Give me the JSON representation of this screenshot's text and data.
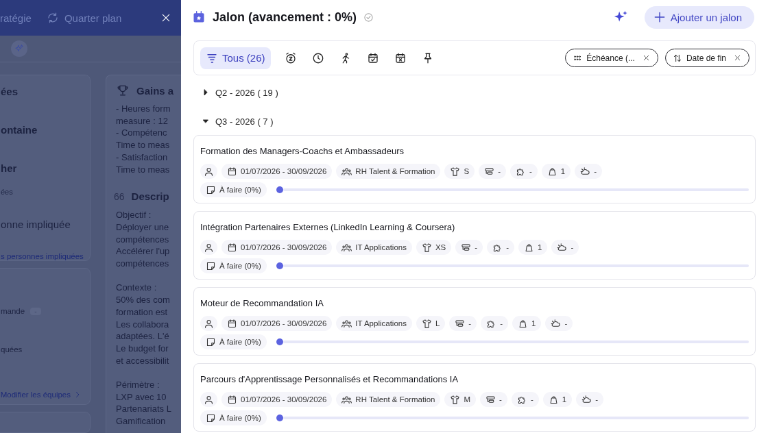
{
  "background_page": {
    "nav_tabs": [
      {
        "label": "ratégie",
        "kind": "text"
      },
      {
        "label": "Quarter plan",
        "kind": "cycle"
      }
    ],
    "people_card": {
      "lines": [
        {
          "kind": "title",
          "text": "ées"
        },
        {
          "kind": "title",
          "text": "ontaine"
        },
        {
          "kind": "title",
          "text": "her"
        },
        {
          "kind": "caption",
          "text": "ées"
        },
        {
          "kind": "body",
          "text": "onne impliquée"
        }
      ],
      "link": "s personnes impliquées"
    },
    "teams_card": {
      "rows": [
        {
          "label": "mande",
          "badge": "-"
        },
        {
          "label": "quées"
        }
      ],
      "link": "Modifier les équipes"
    },
    "gains": {
      "title": "Gains a",
      "lines": [
        "- Heures form",
        "measure : 12",
        "- Compétenc",
        "Time to meas",
        "- Satisfaction",
        "Time to meas"
      ]
    },
    "description": {
      "mark": "66",
      "title": "Descrip",
      "paragraphs": [
        [
          "Objectif :",
          "Déployer une",
          "compétences",
          "Accélérer l'up",
          "compétences"
        ],
        [
          "Contexte :",
          "50% des com",
          "formation est",
          "Les collabora",
          "adaptées. L'é",
          "Le budget for",
          "et accessibilit"
        ],
        [
          "Périmètre :",
          "LXP avec 10",
          "Partenariats L",
          "Gamification"
        ]
      ]
    }
  },
  "drawer": {
    "title": "Jalon (avancement : 0%)",
    "add_button": "Ajouter un jalon",
    "filters": [
      {
        "kind": "all",
        "label": "Tous (26)",
        "selected": true
      },
      {
        "kind": "snooze",
        "selected": false
      },
      {
        "kind": "clock",
        "selected": false
      },
      {
        "kind": "running",
        "selected": false
      },
      {
        "kind": "calendar-check",
        "selected": false
      },
      {
        "kind": "calendar-x",
        "selected": false
      },
      {
        "kind": "pin",
        "selected": false
      }
    ],
    "chips": [
      {
        "kind": "group",
        "label": "Échéance (..."
      },
      {
        "kind": "sort",
        "label": "Date de fin"
      }
    ],
    "groups": [
      {
        "label": "Q2 - 2026 ( 19 )",
        "expanded": false
      },
      {
        "label": "Q3 - 2026 ( 7 )",
        "expanded": true,
        "items": [
          {
            "title": "Formation des Managers-Coachs et Ambassadeurs",
            "dates": "01/07/2026 - 30/09/2026",
            "team": "RH Talent & Formation",
            "size": "S",
            "tasks": "-",
            "dependencies": "-",
            "weight": "1",
            "weather": "-",
            "status": "À faire (0%)",
            "level": 0
          },
          {
            "title": "Intégration Partenaires Externes (LinkedIn Learning & Coursera)",
            "dates": "01/07/2026 - 30/09/2026",
            "team": "IT Applications",
            "size": "XS",
            "tasks": "-",
            "dependencies": "-",
            "weight": "1",
            "weather": "-",
            "status": "À faire (0%)",
            "level": 0
          },
          {
            "title": "Moteur de Recommandation IA",
            "dates": "01/07/2026 - 30/09/2026",
            "team": "IT Applications",
            "size": "L",
            "tasks": "-",
            "dependencies": "-",
            "weight": "1",
            "weather": "-",
            "status": "À faire (0%)",
            "level": 0
          },
          {
            "title": "Parcours d'Apprentissage Personnalisés et Recommandations IA",
            "dates": "01/07/2026 - 30/09/2026",
            "team": "RH Talent & Formation",
            "size": "M",
            "tasks": "-",
            "dependencies": "-",
            "weight": "1",
            "weather": "-",
            "status": "À faire (0%)",
            "level": 0
          }
        ]
      }
    ]
  }
}
